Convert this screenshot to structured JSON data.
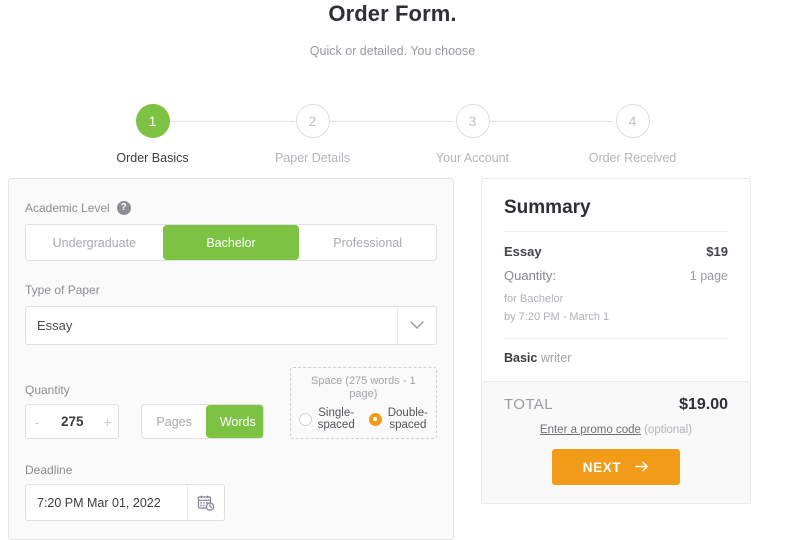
{
  "header": {
    "title": "Order Form.",
    "subtitle": "Quick or detailed. You choose"
  },
  "stepper": {
    "steps": [
      {
        "number": "1",
        "label": "Order Basics",
        "active": true
      },
      {
        "number": "2",
        "label": "Paper Details",
        "active": false
      },
      {
        "number": "3",
        "label": "Your Account",
        "active": false
      },
      {
        "number": "4",
        "label": "Order Received",
        "active": false
      }
    ]
  },
  "form": {
    "academic_level": {
      "label": "Academic Level",
      "help_icon": "help-circle-icon",
      "options": [
        "Undergraduate",
        "Bachelor",
        "Professional"
      ],
      "selected": "Bachelor"
    },
    "type_of_paper": {
      "label": "Type of Paper",
      "value": "Essay",
      "arrow_icon": "chevron-down-icon"
    },
    "quantity": {
      "label": "Quantity",
      "value": "275",
      "decrement": "-",
      "increment": "+",
      "unit_options": [
        "Pages",
        "Words"
      ],
      "unit_selected": "Words"
    },
    "spacing": {
      "title": "Space (275 words - 1 page)",
      "options": [
        "Single-spaced",
        "Double-spaced"
      ],
      "selected": "Double-spaced"
    },
    "deadline": {
      "label": "Deadline",
      "value": "7:20 PM Mar 01, 2022",
      "icon": "calendar-clock-icon"
    }
  },
  "summary": {
    "title": "Summary",
    "paper_type_label": "Essay",
    "paper_type_price": "$19",
    "quantity_label": "Quantity:",
    "quantity_value": "1 page",
    "meta_level": "for Bachelor",
    "meta_deadline": "by 7:20 PM - March 1",
    "writer_level": "Basic",
    "writer_word": "writer",
    "total_label": "TOTAL",
    "total_value": "$19.00",
    "promo_link": "Enter a promo code",
    "promo_optional": "(optional)",
    "next_label": "NEXT",
    "next_icon": "arrow-right-icon"
  },
  "colors": {
    "green": "#7dc242",
    "orange": "#f29b19",
    "text_dark": "#2f2f35",
    "text_muted": "#9a9aa0"
  }
}
